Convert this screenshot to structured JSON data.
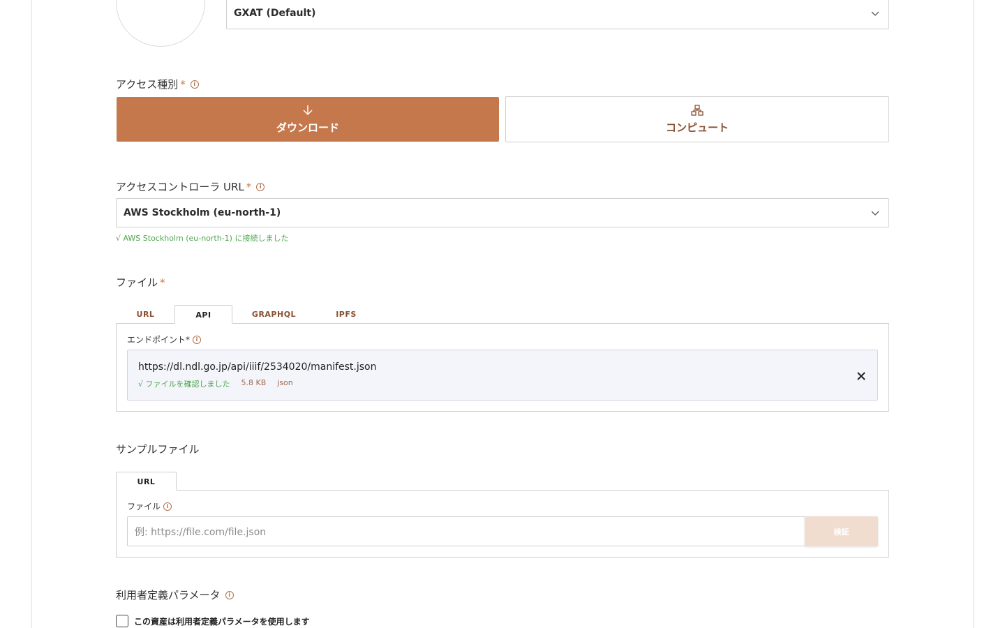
{
  "token_select": {
    "value": "GXAT (Default)"
  },
  "access_type": {
    "label": "アクセス種別",
    "required_mark": "*",
    "options": [
      {
        "label": "ダウンロード",
        "icon": "download-arrow-icon",
        "selected": true
      },
      {
        "label": "コンピュート",
        "icon": "compute-nodes-icon",
        "selected": false
      }
    ]
  },
  "access_controller": {
    "label": "アクセスコントローラ URL",
    "required_mark": "*",
    "value": "AWS Stockholm (eu-north-1)",
    "status": "√ AWS Stockholm (eu-north-1) に接続しました"
  },
  "file": {
    "label": "ファイル",
    "required_mark": "*",
    "tabs": [
      "URL",
      "API",
      "GRAPHQL",
      "IPFS"
    ],
    "active_tab": "API",
    "endpoint_label": "エンドポイント*",
    "endpoint_value": "https://dl.ndl.go.jp/api/iiif/2534020/manifest.json",
    "endpoint_status": "√ ファイルを確認しました",
    "endpoint_size": "5.8 KB",
    "endpoint_type": "json"
  },
  "sample_file": {
    "label": "サンプルファイル",
    "tabs": [
      "URL"
    ],
    "field_label": "ファイル",
    "placeholder": "例: https://file.com/file.json",
    "verify_label": "検証"
  },
  "custom_params": {
    "label": "利用者定義パラメータ",
    "checkbox_label": "この資産は利用者定義パラメータを使用します",
    "checked": false
  },
  "colors": {
    "accent": "#c5784b",
    "accent_text": "#8a5032",
    "success": "#4ea64e",
    "verify_disabled": "#f1dcd0"
  }
}
